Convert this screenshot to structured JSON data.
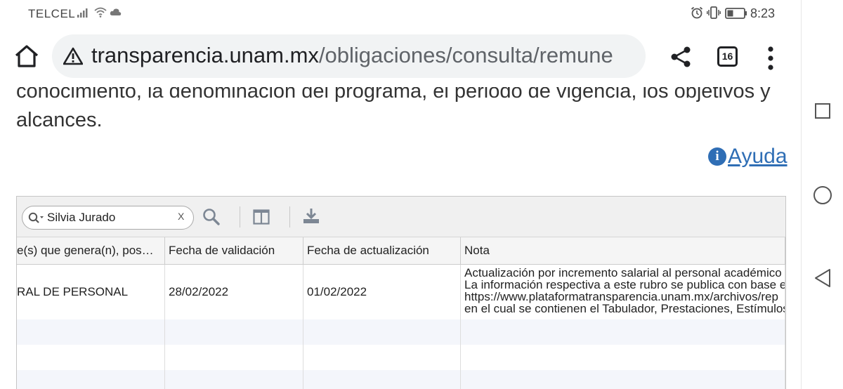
{
  "status_bar": {
    "carrier": "TELCEL",
    "time": "8:23"
  },
  "browser": {
    "url_host": "transparencia.unam.mx",
    "url_path": "/obligaciones/consulta/remune",
    "tab_count": "16"
  },
  "page": {
    "paragraph_line1": "conocimiento, la denominación del programa, el periodo de vigencia, los objetivos y",
    "paragraph_line2": "alcances.",
    "help_label": "Ayuda"
  },
  "grid": {
    "search": {
      "value": "Silvia Jurado",
      "clear_label": "X"
    },
    "columns": [
      "e(s) que genera(n), pos…",
      "Fecha de validación",
      "Fecha de actualización",
      "Nota"
    ],
    "rows": [
      {
        "area": "RAL DE PERSONAL",
        "fecha_validacion": "28/02/2022",
        "fecha_actualizacion": "01/02/2022",
        "nota_lines": [
          "Actualización por incremento salarial al personal académico",
          "La información respectiva a este rubro se publica con base e",
          "https://www.plataformatransparencia.unam.mx/archivos/rep",
          "en el cual se contienen el Tabulador, Prestaciones, Estímulos"
        ]
      }
    ]
  },
  "icons": {
    "home": "home-icon",
    "warning": "warning-icon",
    "share": "share-icon",
    "menu": "more-vert-icon",
    "info": "info-icon",
    "search": "search-icon",
    "columns": "columns-icon",
    "export": "download-icon"
  },
  "colors": {
    "link": "#2f6eb5",
    "grid_toolbar_bg": "#f0f0f0",
    "alt_row_bg": "#f4f6fb"
  }
}
